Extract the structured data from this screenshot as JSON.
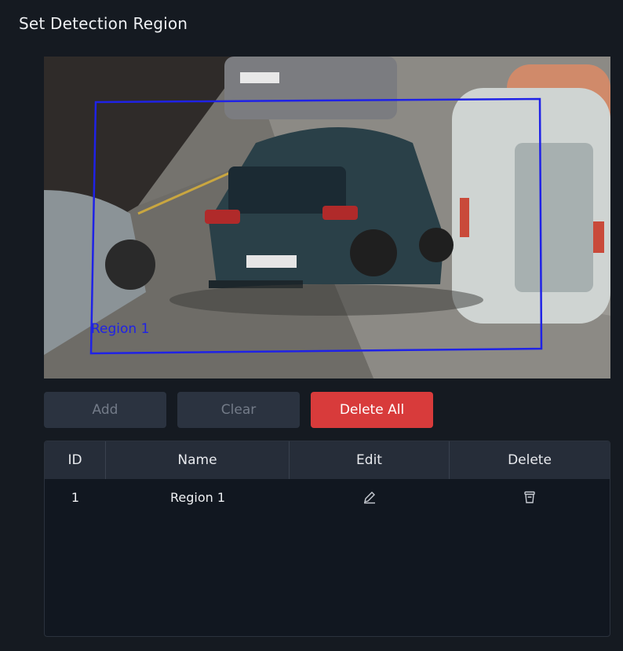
{
  "title": "Set Detection Region",
  "video": {
    "region_label": "Region 1",
    "region_color": "#1f22e6"
  },
  "buttons": {
    "add_label": "Add",
    "clear_label": "Clear",
    "delete_all_label": "Delete All"
  },
  "table": {
    "headers": {
      "id": "ID",
      "name": "Name",
      "edit": "Edit",
      "delete": "Delete"
    },
    "rows": [
      {
        "id": "1",
        "name": "Region 1",
        "edit_icon": "pencil-icon",
        "delete_icon": "trash-icon"
      }
    ]
  },
  "colors": {
    "background": "#151a21",
    "danger": "#d83b3b",
    "disabled_button": "#2b3340",
    "table_header": "#262d39"
  }
}
